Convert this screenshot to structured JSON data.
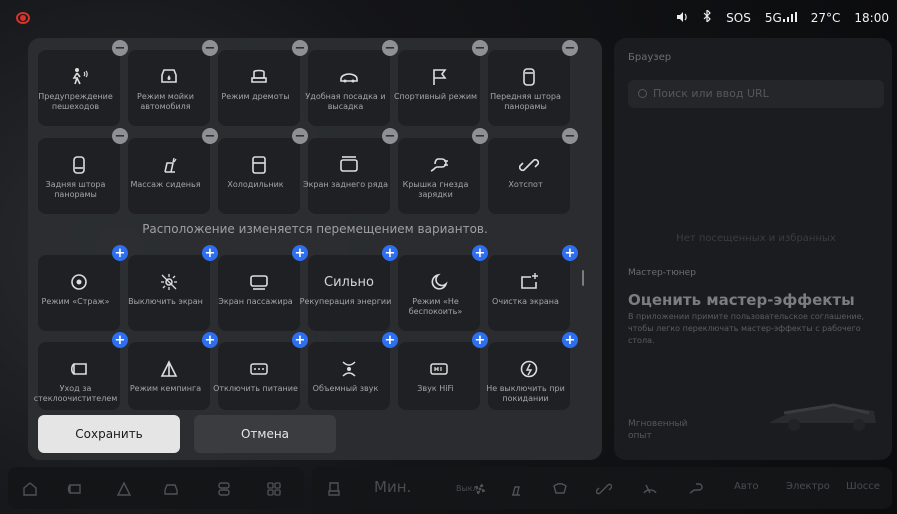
{
  "status": {
    "sos": "SOS",
    "network": "5G",
    "temperature": "27°C",
    "time": "18:00"
  },
  "editor": {
    "active_tiles": [
      {
        "label": "Предупреждение пешеходов",
        "icon": "pedestrian-warning-icon"
      },
      {
        "label": "Режим мойки автомобиля",
        "icon": "car-wash-icon"
      },
      {
        "label": "Режим дремоты",
        "icon": "nap-seat-icon"
      },
      {
        "label": "Удобная посадка и высадка",
        "icon": "easy-entry-icon"
      },
      {
        "label": "Спортивный режим",
        "icon": "sport-flag-icon"
      },
      {
        "label": "Передняя штора панорамы",
        "icon": "front-shade-icon"
      },
      {
        "label": "Задняя штора панорамы",
        "icon": "rear-shade-icon"
      },
      {
        "label": "Массаж сиденья",
        "icon": "seat-massage-icon"
      },
      {
        "label": "Холодильник",
        "icon": "fridge-icon"
      },
      {
        "label": "Экран заднего ряда",
        "icon": "rear-screen-icon"
      },
      {
        "label": "Крышка гнезда зарядки",
        "icon": "charge-port-icon"
      },
      {
        "label": "Хотспот",
        "icon": "hotspot-icon"
      }
    ],
    "hint": "Расположение изменяется перемещением вариантов.",
    "available_tiles": [
      {
        "label": "Режим «Страж»",
        "icon": "sentry-icon"
      },
      {
        "label": "Выключить экран",
        "icon": "screen-off-icon"
      },
      {
        "label": "Экран пассажира",
        "icon": "passenger-screen-icon"
      },
      {
        "label": "Рекуперация энергии",
        "value": "Сильно"
      },
      {
        "label": "Режим «Не беспокоить»",
        "icon": "moon-icon"
      },
      {
        "label": "Очистка экрана",
        "icon": "clean-screen-icon"
      },
      {
        "label": "Уход за стеклоочистителем",
        "icon": "wiper-icon"
      },
      {
        "label": "Режим кемпинга",
        "icon": "camping-icon"
      },
      {
        "label": "Отключить питание",
        "icon": "power-off-icon"
      },
      {
        "label": "Объемный звук",
        "icon": "surround-sound-icon"
      },
      {
        "label": "Звук HiFi",
        "icon": "hifi-icon"
      },
      {
        "label": "Не выключить при покидании",
        "icon": "keep-on-icon"
      }
    ],
    "save_label": "Сохранить",
    "cancel_label": "Отмена",
    "remove_symbol": "−",
    "add_symbol": "+"
  },
  "background_panel": {
    "browser_title": "Браузер",
    "search_placeholder": "Поиск или ввод URL",
    "empty_text": "Нет посещенных и избранных",
    "tuner_title": "Мастер-тюнер",
    "heading": "Оценить мастер-эффекты",
    "description": "В приложении примите пользовательское соглашение, чтобы легко переключать мастер-эффекты с рабочего стола.",
    "instant_label": "Мгновенный опыт"
  },
  "dock": {
    "fan_value": "Мин.",
    "fan_off": "Выкл",
    "modes": [
      "Авто",
      "Электро",
      "Шоссе"
    ]
  },
  "colors": {
    "accent": "#2d6ff0",
    "record": "#d8332a"
  }
}
